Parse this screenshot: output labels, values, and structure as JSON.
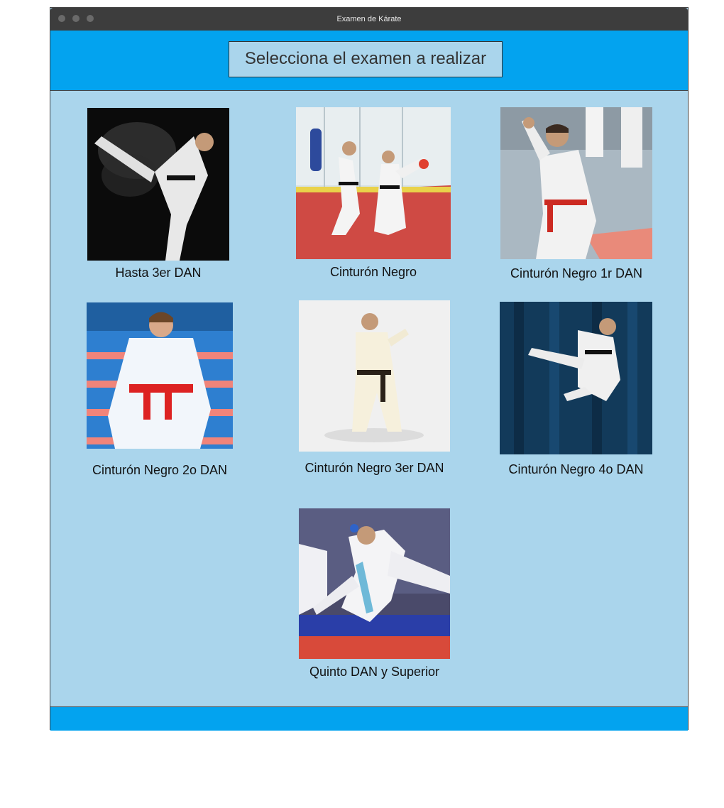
{
  "window": {
    "title": "Examen de Kárate"
  },
  "header": {
    "title": "Selecciona el examen a realizar"
  },
  "exams": [
    {
      "label": "Hasta 3er DAN"
    },
    {
      "label": "Cinturón Negro"
    },
    {
      "label": "Cinturón Negro 1r DAN"
    },
    {
      "label": "Cinturón Negro 2o DAN"
    },
    {
      "label": "Cinturón Negro 3er DAN"
    },
    {
      "label": "Cinturón Negro 4o DAN"
    },
    {
      "label": "Quinto DAN y Superior"
    }
  ]
}
